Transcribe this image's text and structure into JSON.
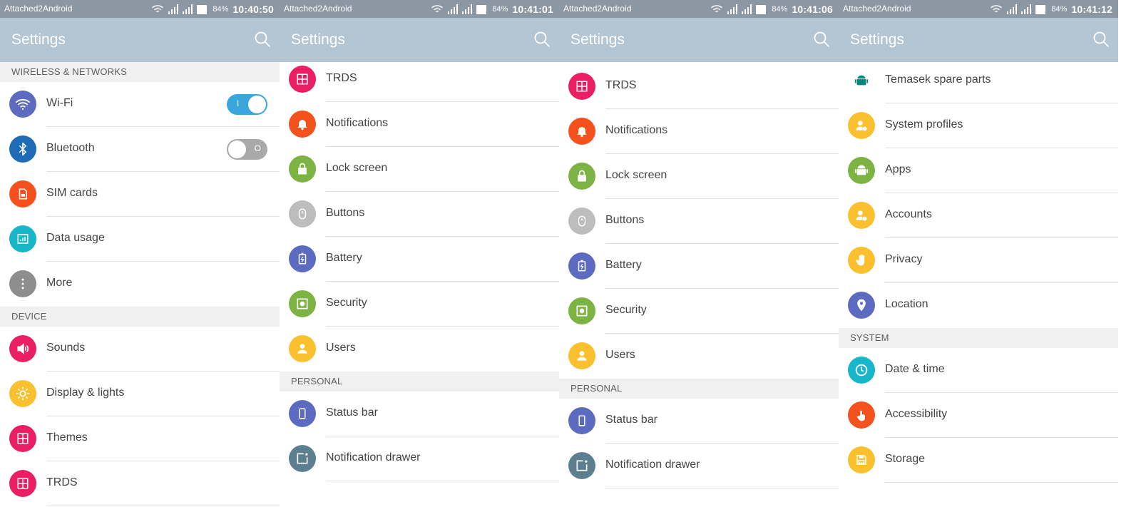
{
  "app_title": "Settings",
  "colors": {
    "status_bar": "#8b98a4",
    "app_bar": "#b4c5d3",
    "toggle_on": "#3aa6db",
    "toggle_off": "#a9a9a9"
  },
  "panels": [
    {
      "status": {
        "carrier": "Attached2Android",
        "battery": "84%",
        "time": "10:40:50"
      },
      "items": [
        {
          "type": "header",
          "label": "WIRELESS & NETWORKS"
        },
        {
          "type": "item",
          "label": "Wi-Fi",
          "icon": "wifi-icon",
          "color": "#5c6bc0",
          "toggle": "on",
          "toggle_mark": "I"
        },
        {
          "type": "item",
          "label": "Bluetooth",
          "icon": "bluetooth-icon",
          "color": "#1e6bb8",
          "toggle": "off",
          "toggle_mark": "O"
        },
        {
          "type": "item",
          "label": "SIM cards",
          "icon": "sim-card-icon",
          "color": "#f4511e"
        },
        {
          "type": "item",
          "label": "Data usage",
          "icon": "data-usage-icon",
          "color": "#17b6c9"
        },
        {
          "type": "item",
          "label": "More",
          "icon": "more-icon",
          "color": "#8e8e8e"
        },
        {
          "type": "header",
          "label": "DEVICE"
        },
        {
          "type": "item",
          "label": "Sounds",
          "icon": "sound-icon",
          "color": "#e91e63"
        },
        {
          "type": "item",
          "label": "Display & lights",
          "icon": "brightness-icon",
          "color": "#fbc02d"
        },
        {
          "type": "item",
          "label": "Themes",
          "icon": "grid-icon",
          "color": "#e91e63"
        },
        {
          "type": "item",
          "label": "TRDS",
          "icon": "grid-icon",
          "color": "#e91e63"
        }
      ]
    },
    {
      "status": {
        "carrier": "Attached2Android",
        "battery": "84%",
        "time": "10:41:01"
      },
      "items": [
        {
          "type": "item",
          "label": "TRDS",
          "icon": "grid-icon",
          "color": "#e91e63"
        },
        {
          "type": "item",
          "label": "Notifications",
          "icon": "bell-icon",
          "color": "#f4511e"
        },
        {
          "type": "item",
          "label": "Lock screen",
          "icon": "lock-icon",
          "color": "#7cb342"
        },
        {
          "type": "item",
          "label": "Buttons",
          "icon": "mouse-icon",
          "color": "#bdbdbd"
        },
        {
          "type": "item",
          "label": "Battery",
          "icon": "battery-icon",
          "color": "#5c6bc0"
        },
        {
          "type": "item",
          "label": "Security",
          "icon": "security-icon",
          "color": "#7cb342"
        },
        {
          "type": "item",
          "label": "Users",
          "icon": "user-icon",
          "color": "#fbc02d"
        },
        {
          "type": "header",
          "label": "PERSONAL"
        },
        {
          "type": "item",
          "label": "Status bar",
          "icon": "phone-icon",
          "color": "#5c6bc0"
        },
        {
          "type": "item",
          "label": "Notification drawer",
          "icon": "drawer-icon",
          "color": "#5b7f8f"
        }
      ]
    },
    {
      "status": {
        "carrier": "Attached2Android",
        "battery": "84%",
        "time": "10:41:06"
      },
      "items": [
        {
          "type": "item",
          "label": "TRDS",
          "icon": "grid-icon",
          "color": "#e91e63"
        },
        {
          "type": "item",
          "label": "Notifications",
          "icon": "bell-icon",
          "color": "#f4511e"
        },
        {
          "type": "item",
          "label": "Lock screen",
          "icon": "lock-icon",
          "color": "#7cb342"
        },
        {
          "type": "item",
          "label": "Buttons",
          "icon": "mouse-icon",
          "color": "#bdbdbd"
        },
        {
          "type": "item",
          "label": "Battery",
          "icon": "battery-icon",
          "color": "#5c6bc0"
        },
        {
          "type": "item",
          "label": "Security",
          "icon": "security-icon",
          "color": "#7cb342"
        },
        {
          "type": "item",
          "label": "Users",
          "icon": "user-icon",
          "color": "#fbc02d"
        },
        {
          "type": "header",
          "label": "PERSONAL"
        },
        {
          "type": "item",
          "label": "Status bar",
          "icon": "phone-icon",
          "color": "#5c6bc0"
        },
        {
          "type": "item",
          "label": "Notification drawer",
          "icon": "drawer-icon",
          "color": "#5b7f8f"
        }
      ]
    },
    {
      "status": {
        "carrier": "Attached2Android",
        "battery": "84%",
        "time": "10:41:12"
      },
      "items": [
        {
          "type": "item",
          "label": "Temasek spare parts",
          "icon": "android-icon",
          "color": "#00897b",
          "plain": true
        },
        {
          "type": "item",
          "label": "System profiles",
          "icon": "profile-icon",
          "color": "#fbc02d"
        },
        {
          "type": "item",
          "label": "Apps",
          "icon": "android-icon",
          "color": "#7cb342"
        },
        {
          "type": "item",
          "label": "Accounts",
          "icon": "account-icon",
          "color": "#fbc02d"
        },
        {
          "type": "item",
          "label": "Privacy",
          "icon": "hand-icon",
          "color": "#fbc02d"
        },
        {
          "type": "item",
          "label": "Location",
          "icon": "location-icon",
          "color": "#5c6bc0"
        },
        {
          "type": "header",
          "label": "SYSTEM"
        },
        {
          "type": "item",
          "label": "Date & time",
          "icon": "clock-icon",
          "color": "#17b6c9"
        },
        {
          "type": "item",
          "label": "Accessibility",
          "icon": "accessibility-icon",
          "color": "#f4511e"
        },
        {
          "type": "item",
          "label": "Storage",
          "icon": "storage-icon",
          "color": "#fbc02d"
        }
      ]
    }
  ]
}
